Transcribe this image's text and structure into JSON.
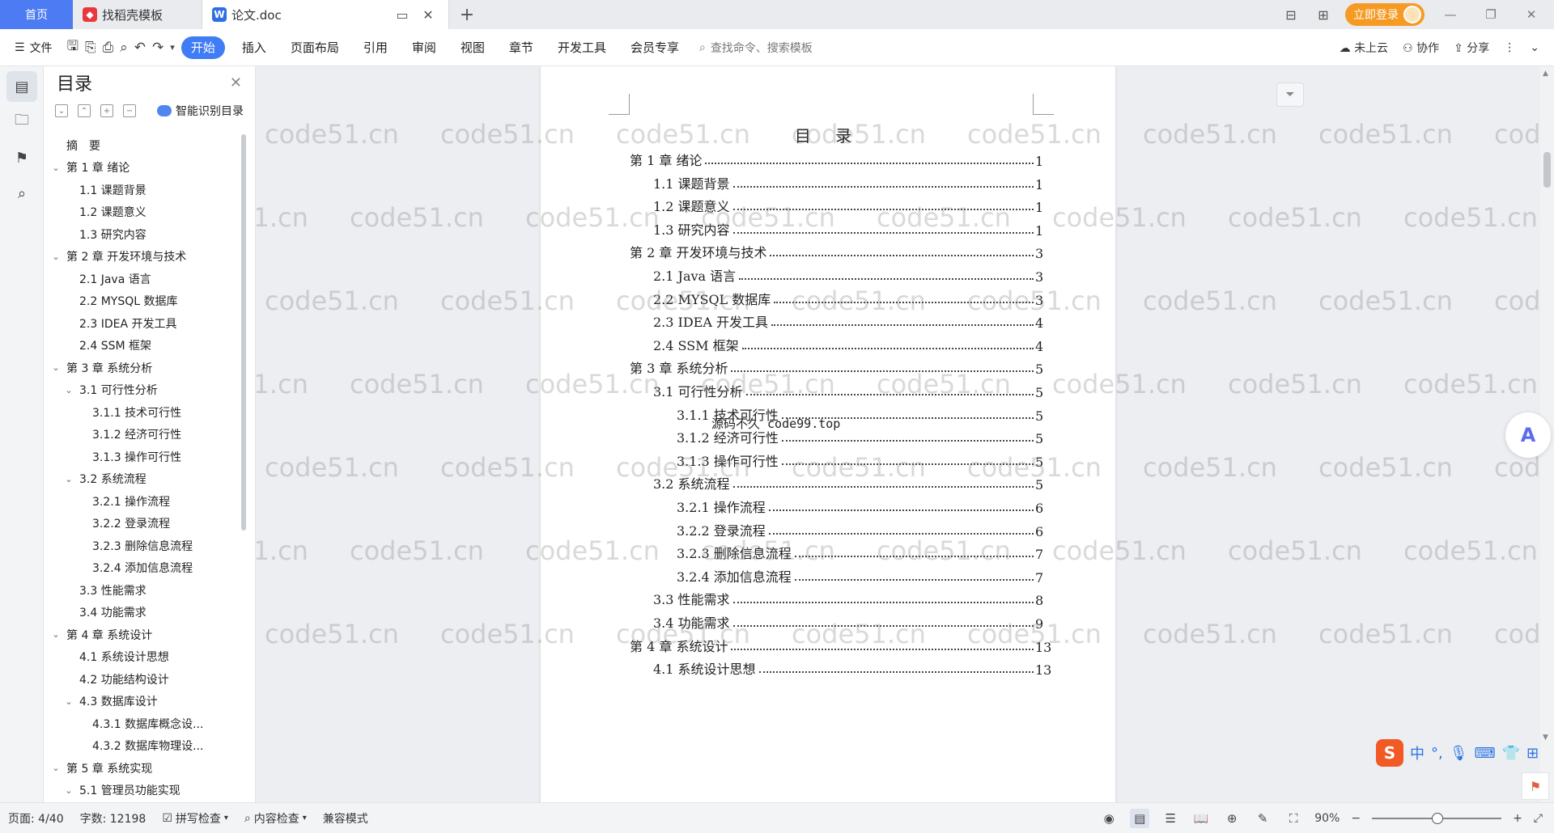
{
  "tabs": {
    "home": "首页",
    "template": "找稻壳模板",
    "doc": "论文.doc"
  },
  "login": "立即登录",
  "ribbon": {
    "file": "文件",
    "menus": [
      "开始",
      "插入",
      "页面布局",
      "引用",
      "审阅",
      "视图",
      "章节",
      "开发工具",
      "会员专享"
    ],
    "search_placeholder": "查找命令、搜索模板",
    "cloud": "未上云",
    "collab": "协作",
    "share": "分享"
  },
  "toc_pane": {
    "title": "目录",
    "smart_label": "智能识别目录",
    "items": [
      {
        "text": "摘　要",
        "level": 0,
        "chev": ""
      },
      {
        "text": "第 1 章  绪论",
        "level": 0,
        "chev": "v"
      },
      {
        "text": "1.1   课题背景",
        "level": 1,
        "chev": ""
      },
      {
        "text": "1.2   课题意义",
        "level": 1,
        "chev": ""
      },
      {
        "text": "1.3   研究内容",
        "level": 1,
        "chev": ""
      },
      {
        "text": "第 2 章  开发环境与技术",
        "level": 0,
        "chev": "v"
      },
      {
        "text": "2.1 Java 语言",
        "level": 1,
        "chev": ""
      },
      {
        "text": "2.2 MYSQL 数据库",
        "level": 1,
        "chev": ""
      },
      {
        "text": "2.3 IDEA 开发工具",
        "level": 1,
        "chev": ""
      },
      {
        "text": "2.4 SSM 框架",
        "level": 1,
        "chev": ""
      },
      {
        "text": "第 3 章  系统分析",
        "level": 0,
        "chev": "v"
      },
      {
        "text": "3.1   可行性分析",
        "level": 1,
        "chev": "v"
      },
      {
        "text": "3.1.1   技术可行性",
        "level": 2,
        "chev": ""
      },
      {
        "text": "3.1.2   经济可行性",
        "level": 2,
        "chev": ""
      },
      {
        "text": "3.1.3   操作可行性",
        "level": 2,
        "chev": ""
      },
      {
        "text": "3.2   系统流程",
        "level": 1,
        "chev": "v"
      },
      {
        "text": "3.2.1   操作流程",
        "level": 2,
        "chev": ""
      },
      {
        "text": "3.2.2   登录流程",
        "level": 2,
        "chev": ""
      },
      {
        "text": "3.2.3   删除信息流程",
        "level": 2,
        "chev": ""
      },
      {
        "text": "3.2.4   添加信息流程",
        "level": 2,
        "chev": ""
      },
      {
        "text": "3.3   性能需求",
        "level": 1,
        "chev": ""
      },
      {
        "text": "3.4   功能需求",
        "level": 1,
        "chev": ""
      },
      {
        "text": "第 4 章  系统设计",
        "level": 0,
        "chev": "v"
      },
      {
        "text": "4.1   系统设计思想",
        "level": 1,
        "chev": ""
      },
      {
        "text": "4.2   功能结构设计",
        "level": 1,
        "chev": ""
      },
      {
        "text": "4.3   数据库设计",
        "level": 1,
        "chev": "v"
      },
      {
        "text": "4.3.1   数据库概念设...",
        "level": 2,
        "chev": ""
      },
      {
        "text": "4.3.2   数据库物理设...",
        "level": 2,
        "chev": ""
      },
      {
        "text": "第 5 章  系统实现",
        "level": 0,
        "chev": "v"
      },
      {
        "text": "5.1   管理员功能实现",
        "level": 1,
        "chev": "v"
      }
    ]
  },
  "document": {
    "title": "目  录",
    "overlay": "源码不久 code99.top",
    "entries": [
      {
        "text": "第 1 章  绪论",
        "page": "1",
        "level": 0
      },
      {
        "text": "1.1  课题背景",
        "page": "1",
        "level": 1
      },
      {
        "text": "1.2  课题意义",
        "page": "1",
        "level": 1
      },
      {
        "text": "1.3  研究内容",
        "page": "1",
        "level": 1
      },
      {
        "text": "第 2 章  开发环境与技术",
        "page": "3",
        "level": 0
      },
      {
        "text": "2.1 Java 语言",
        "page": "3",
        "level": 1
      },
      {
        "text": "2.2 MYSQL 数据库",
        "page": "3",
        "level": 1
      },
      {
        "text": "2.3 IDEA 开发工具",
        "page": "4",
        "level": 1
      },
      {
        "text": "2.4 SSM 框架",
        "page": "4",
        "level": 1
      },
      {
        "text": "第 3 章  系统分析",
        "page": "5",
        "level": 0
      },
      {
        "text": "3.1  可行性分析",
        "page": "5",
        "level": 1
      },
      {
        "text": "3.1.1  技术可行性",
        "page": "5",
        "level": 2
      },
      {
        "text": "3.1.2  经济可行性",
        "page": "5",
        "level": 2
      },
      {
        "text": "3.1.3  操作可行性",
        "page": "5",
        "level": 2
      },
      {
        "text": "3.2  系统流程",
        "page": "5",
        "level": 1
      },
      {
        "text": "3.2.1  操作流程",
        "page": "6",
        "level": 2
      },
      {
        "text": "3.2.2  登录流程",
        "page": "6",
        "level": 2
      },
      {
        "text": "3.2.3  删除信息流程",
        "page": "7",
        "level": 2
      },
      {
        "text": "3.2.4  添加信息流程",
        "page": "7",
        "level": 2
      },
      {
        "text": "3.3  性能需求",
        "page": "8",
        "level": 1
      },
      {
        "text": "3.4  功能需求",
        "page": "9",
        "level": 1
      },
      {
        "text": "第 4 章  系统设计",
        "page": "13",
        "level": 0
      },
      {
        "text": "4.1  系统设计思想",
        "page": "13",
        "level": 1
      }
    ]
  },
  "watermark": "code51.cn",
  "status": {
    "page": "页面: 4/40",
    "words": "字数: 12198",
    "spell": "拼写检查",
    "content": "内容检查",
    "compat": "兼容模式",
    "zoom": "90%"
  },
  "ime": {
    "lang": "中"
  },
  "colors": {
    "accent": "#3f7cf5",
    "home_tab": "#4c7bf3",
    "login": "#f59a23"
  }
}
